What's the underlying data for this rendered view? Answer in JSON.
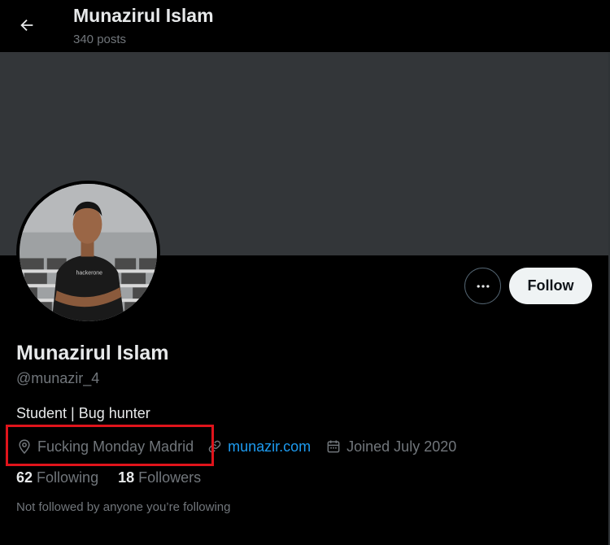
{
  "header": {
    "name": "Munazirul Islam",
    "posts_count": "340 posts"
  },
  "profile": {
    "name": "Munazirul Islam",
    "handle": "@munazir_4",
    "bio": "Student | Bug hunter",
    "location": "Fucking Monday Madrid",
    "website": "munazir.com",
    "joined": "Joined July 2020",
    "following_count": "62",
    "following_label": "Following",
    "followers_count": "18",
    "followers_label": "Followers",
    "mutuals_note": "Not followed by anyone you’re following"
  },
  "actions": {
    "follow_label": "Follow",
    "more_icon": "more-dots-icon",
    "back_icon": "back-arrow-icon"
  },
  "icons": {
    "location": "location-pin-icon",
    "link": "link-icon",
    "calendar": "calendar-icon"
  },
  "colors": {
    "background": "#000000",
    "banner": "#333639",
    "accent_link": "#1d9bf0",
    "secondary_text": "#71767b",
    "highlight_box": "#e0141b",
    "follow_button_bg": "#eff3f4"
  }
}
